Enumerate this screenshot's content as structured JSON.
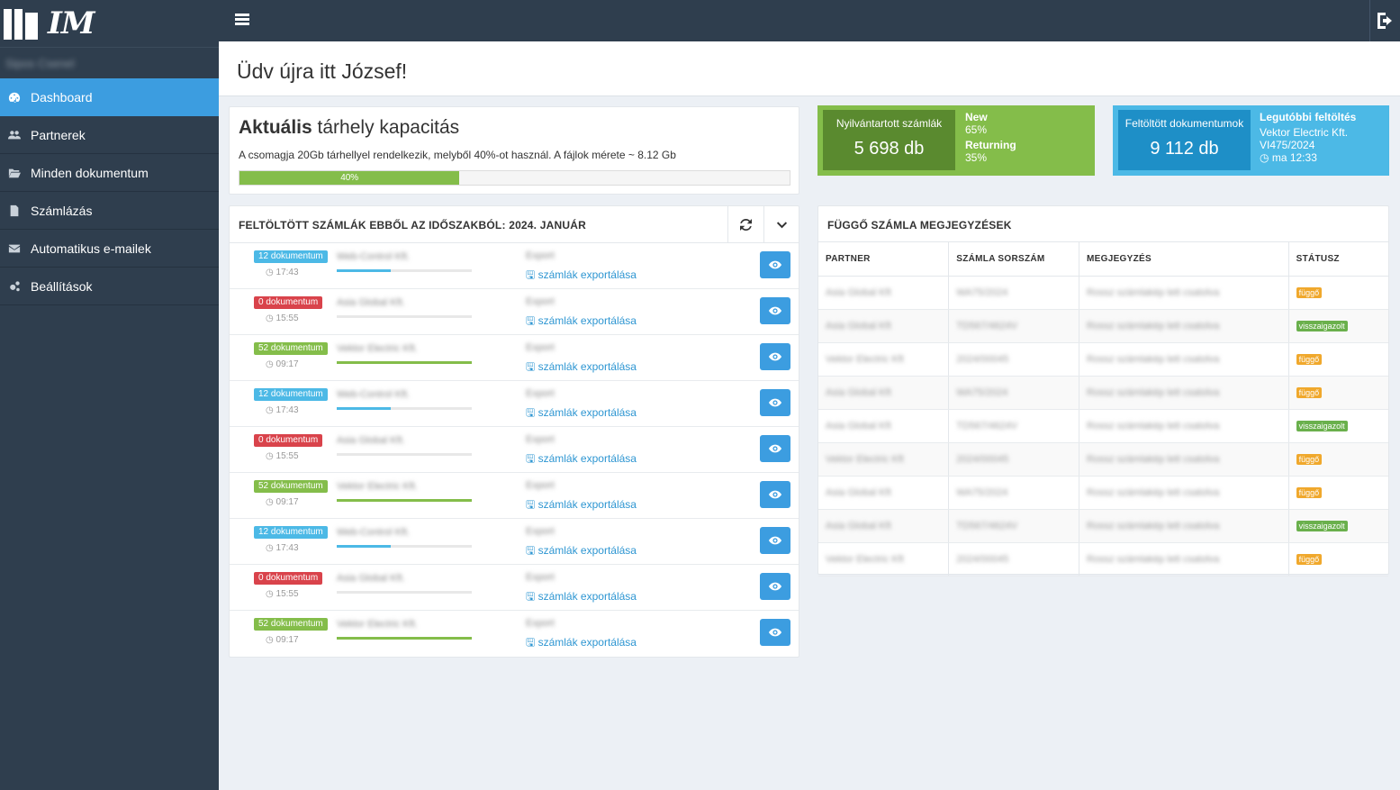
{
  "app": {
    "logo_text": "IM",
    "user_name": "Sipos Csenel"
  },
  "sidebar": {
    "items": [
      {
        "label": "Dashboard",
        "icon": "dashboard-icon",
        "active": true
      },
      {
        "label": "Partnerek",
        "icon": "users-icon"
      },
      {
        "label": "Minden dokumentum",
        "icon": "folder-open-icon"
      },
      {
        "label": "Számlázás",
        "icon": "file-text-icon"
      },
      {
        "label": "Automatikus e-mailek",
        "icon": "envelope-icon"
      },
      {
        "label": "Beállítások",
        "icon": "cogs-icon"
      }
    ]
  },
  "header": {
    "title": "Üdv újra itt József!"
  },
  "storage": {
    "title_bold": "Aktuális",
    "title_rest": " tárhely kapacitás",
    "description": "A csomagja 20Gb tárhellyel rendelkezik, melyből 40%-ot használ. A fájlok mérete ~ 8.12 Gb",
    "percent": 40,
    "percent_label": "40%"
  },
  "stats": {
    "invoices": {
      "label": "Nyilvántartott számlák",
      "value": "5 698 db",
      "new_label": "New",
      "new_value": "65%",
      "ret_label": "Returning",
      "ret_value": "35%"
    },
    "documents": {
      "label": "Feltöltött dokumentumok",
      "value": "9 112 db",
      "latest_label": "Legutóbbi feltöltés",
      "latest_company": "Vektor Electric Kft.",
      "latest_ref": "VI475/2024",
      "latest_time": "ma 12:33"
    }
  },
  "uploaded": {
    "title": "FELTÖLTÖTT SZÁMLÁK EBBŐL AZ IDŐSZAKBÓL: 2024. JANUÁR",
    "rows": [
      {
        "badge": "12 dokumentum",
        "badge_color": "#4cb9e6",
        "time": "17:43",
        "company": "Web-Control Kft.",
        "progress": 40,
        "bar_color": "#4cb9e6",
        "export_top": "Export",
        "export_link": "számlák exportálása"
      },
      {
        "badge": "0 dokumentum",
        "badge_color": "#d9434b",
        "time": "15:55",
        "company": "Asia Global Kft.",
        "progress": 0,
        "bar_color": "#d9434b",
        "export_top": "Export",
        "export_link": "számlák exportálása"
      },
      {
        "badge": "52 dokumentum",
        "badge_color": "#84bd4a",
        "time": "09:17",
        "company": "Vektor Electric Kft.",
        "progress": 100,
        "bar_color": "#84bd4a",
        "export_top": "Export",
        "export_link": "számlák exportálása"
      },
      {
        "badge": "12 dokumentum",
        "badge_color": "#4cb9e6",
        "time": "17:43",
        "company": "Web-Control Kft.",
        "progress": 40,
        "bar_color": "#4cb9e6",
        "export_top": "Export",
        "export_link": "számlák exportálása"
      },
      {
        "badge": "0 dokumentum",
        "badge_color": "#d9434b",
        "time": "15:55",
        "company": "Asia Global Kft.",
        "progress": 0,
        "bar_color": "#d9434b",
        "export_top": "Export",
        "export_link": "számlák exportálása"
      },
      {
        "badge": "52 dokumentum",
        "badge_color": "#84bd4a",
        "time": "09:17",
        "company": "Vektor Electric Kft.",
        "progress": 100,
        "bar_color": "#84bd4a",
        "export_top": "Export",
        "export_link": "számlák exportálása"
      },
      {
        "badge": "12 dokumentum",
        "badge_color": "#4cb9e6",
        "time": "17:43",
        "company": "Web-Control Kft.",
        "progress": 40,
        "bar_color": "#4cb9e6",
        "export_top": "Export",
        "export_link": "számlák exportálása"
      },
      {
        "badge": "0 dokumentum",
        "badge_color": "#d9434b",
        "time": "15:55",
        "company": "Asia Global Kft.",
        "progress": 0,
        "bar_color": "#d9434b",
        "export_top": "Export",
        "export_link": "számlák exportálása"
      },
      {
        "badge": "52 dokumentum",
        "badge_color": "#84bd4a",
        "time": "09:17",
        "company": "Vektor Electric Kft.",
        "progress": 100,
        "bar_color": "#84bd4a",
        "export_top": "Export",
        "export_link": "számlák exportálása"
      }
    ]
  },
  "pending": {
    "title": "FÜGGŐ SZÁMLA MEGJEGYZÉSEK",
    "columns": [
      "PARTNER",
      "SZÁMLA SORSZÁM",
      "MEGJEGYZÉS",
      "STÁTUSZ"
    ],
    "rows": [
      {
        "partner": "Asia Global Kft",
        "number": "WA75/2024",
        "note": "Rossz számlakép lett csatolva",
        "status": "függő",
        "status_color": "#f0a82c"
      },
      {
        "partner": "Asia Global Kft",
        "number": "TD567/4624V",
        "note": "Rossz számlakép lett csatolva",
        "status": "visszaigazolt",
        "status_color": "#6ab04c"
      },
      {
        "partner": "Vektor Electric Kft",
        "number": "2024/00045",
        "note": "Rossz számlakép lett csatolva",
        "status": "függő",
        "status_color": "#f0a82c"
      },
      {
        "partner": "Asia Global Kft",
        "number": "WA75/2024",
        "note": "Rossz számlakép lett csatolva",
        "status": "függő",
        "status_color": "#f0a82c"
      },
      {
        "partner": "Asia Global Kft",
        "number": "TD567/4624V",
        "note": "Rossz számlakép lett csatolva",
        "status": "visszaigazolt",
        "status_color": "#6ab04c"
      },
      {
        "partner": "Vektor Electric Kft",
        "number": "2024/00045",
        "note": "Rossz számlakép lett csatolva",
        "status": "függő",
        "status_color": "#f0a82c"
      },
      {
        "partner": "Asia Global Kft",
        "number": "WA75/2024",
        "note": "Rossz számlakép lett csatolva",
        "status": "függő",
        "status_color": "#f0a82c"
      },
      {
        "partner": "Asia Global Kft",
        "number": "TD567/4624V",
        "note": "Rossz számlakép lett csatolva",
        "status": "visszaigazolt",
        "status_color": "#6ab04c"
      },
      {
        "partner": "Vektor Electric Kft",
        "number": "2024/00045",
        "note": "Rossz számlakép lett csatolva",
        "status": "függő",
        "status_color": "#f0a82c"
      }
    ]
  }
}
